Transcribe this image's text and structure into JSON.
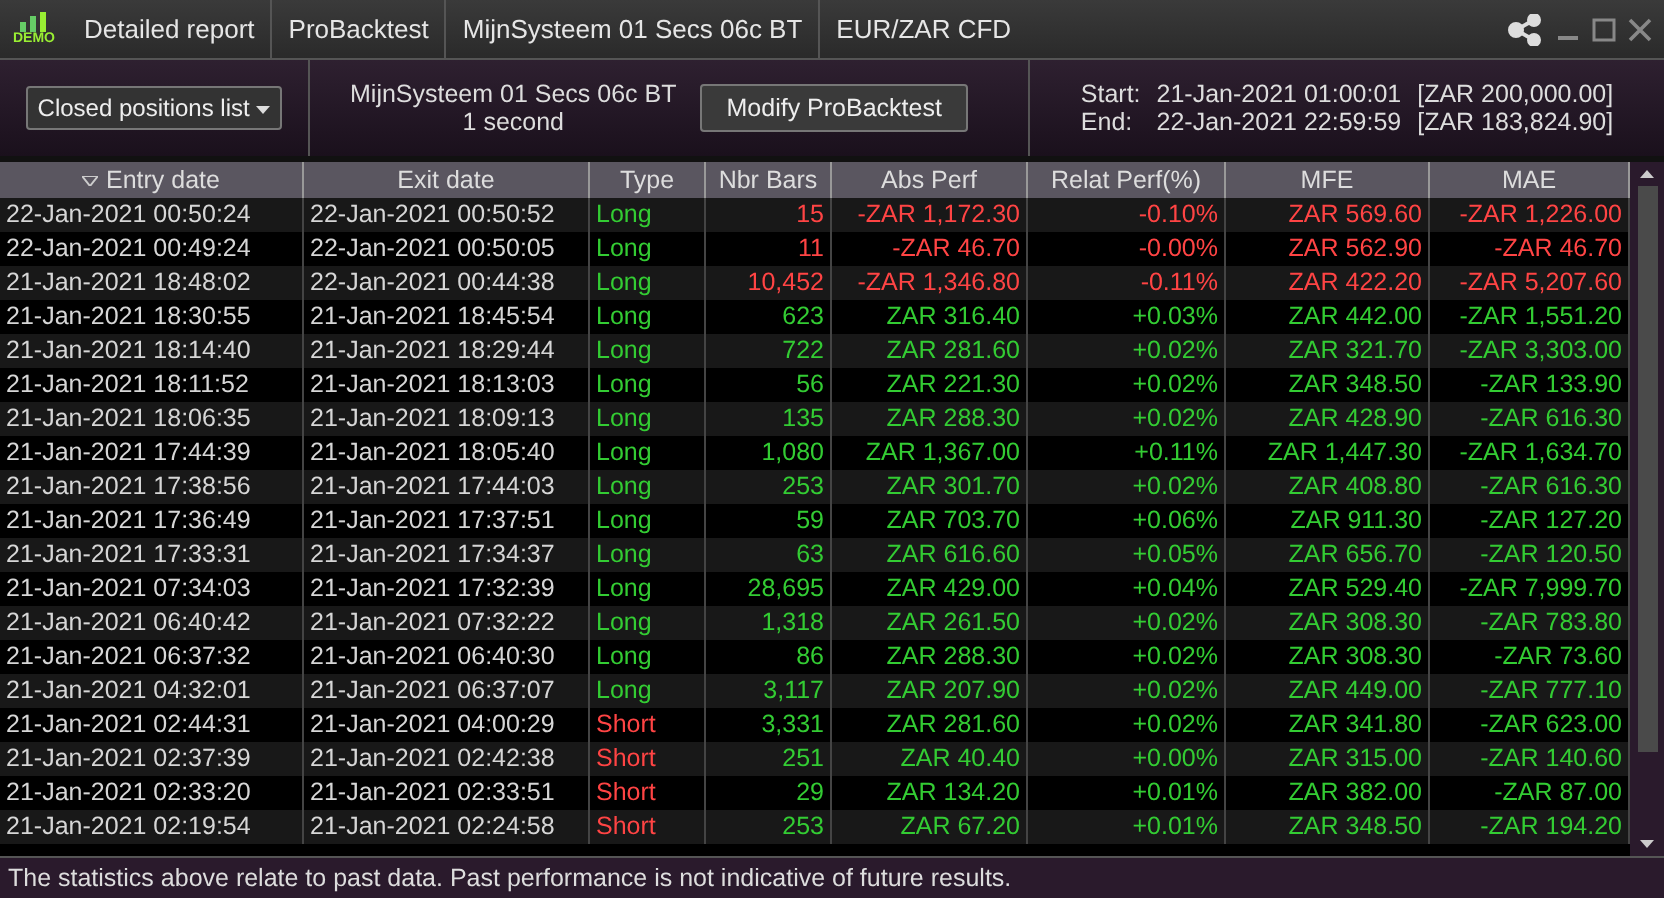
{
  "title_bar": {
    "logo_text": "DEMO",
    "tabs": [
      "Detailed report",
      "ProBacktest",
      "MijnSysteem 01 Secs 06c BT",
      "EUR/ZAR CFD"
    ]
  },
  "toolbar": {
    "list_dropdown": "Closed positions list",
    "system_name": "MijnSysteem 01 Secs 06c BT",
    "timeframe": "1 second",
    "modify_button": "Modify ProBacktest",
    "start_label": "Start:",
    "start_date": "21-Jan-2021 01:00:01",
    "start_capital": "[ZAR 200,000.00]",
    "end_label": "End:",
    "end_date": "22-Jan-2021 22:59:59",
    "end_capital": "[ZAR 183,824.90]"
  },
  "table": {
    "columns": [
      {
        "label": "Entry date",
        "sorted": true
      },
      {
        "label": "Exit date",
        "sorted": false
      },
      {
        "label": "Type",
        "sorted": false
      },
      {
        "label": "Nbr Bars",
        "sorted": false
      },
      {
        "label": "Abs Perf",
        "sorted": false
      },
      {
        "label": "Relat Perf(%)",
        "sorted": false
      },
      {
        "label": "MFE",
        "sorted": false
      },
      {
        "label": "MAE",
        "sorted": false
      }
    ],
    "rows": [
      {
        "entry": "22-Jan-2021 00:50:24",
        "exit": "22-Jan-2021 00:50:52",
        "type": "Long",
        "kind": "long",
        "loss": true,
        "bars": "15",
        "abs": "-ZAR 1,172.30",
        "rel": "-0.10%",
        "mfe": "ZAR 569.60",
        "mae": "-ZAR 1,226.00"
      },
      {
        "entry": "22-Jan-2021 00:49:24",
        "exit": "22-Jan-2021 00:50:05",
        "type": "Long",
        "kind": "long",
        "loss": true,
        "bars": "11",
        "abs": "-ZAR 46.70",
        "rel": "-0.00%",
        "mfe": "ZAR 562.90",
        "mae": "-ZAR 46.70"
      },
      {
        "entry": "21-Jan-2021 18:48:02",
        "exit": "22-Jan-2021 00:44:38",
        "type": "Long",
        "kind": "long",
        "loss": true,
        "bars": "10,452",
        "abs": "-ZAR 1,346.80",
        "rel": "-0.11%",
        "mfe": "ZAR 422.20",
        "mae": "-ZAR 5,207.60"
      },
      {
        "entry": "21-Jan-2021 18:30:55",
        "exit": "21-Jan-2021 18:45:54",
        "type": "Long",
        "kind": "long",
        "loss": false,
        "bars": "623",
        "abs": "ZAR 316.40",
        "rel": "+0.03%",
        "mfe": "ZAR 442.00",
        "mae": "-ZAR 1,551.20"
      },
      {
        "entry": "21-Jan-2021 18:14:40",
        "exit": "21-Jan-2021 18:29:44",
        "type": "Long",
        "kind": "long",
        "loss": false,
        "bars": "722",
        "abs": "ZAR 281.60",
        "rel": "+0.02%",
        "mfe": "ZAR 321.70",
        "mae": "-ZAR 3,303.00"
      },
      {
        "entry": "21-Jan-2021 18:11:52",
        "exit": "21-Jan-2021 18:13:03",
        "type": "Long",
        "kind": "long",
        "loss": false,
        "bars": "56",
        "abs": "ZAR 221.30",
        "rel": "+0.02%",
        "mfe": "ZAR 348.50",
        "mae": "-ZAR 133.90"
      },
      {
        "entry": "21-Jan-2021 18:06:35",
        "exit": "21-Jan-2021 18:09:13",
        "type": "Long",
        "kind": "long",
        "loss": false,
        "bars": "135",
        "abs": "ZAR 288.30",
        "rel": "+0.02%",
        "mfe": "ZAR 428.90",
        "mae": "-ZAR 616.30"
      },
      {
        "entry": "21-Jan-2021 17:44:39",
        "exit": "21-Jan-2021 18:05:40",
        "type": "Long",
        "kind": "long",
        "loss": false,
        "bars": "1,080",
        "abs": "ZAR 1,367.00",
        "rel": "+0.11%",
        "mfe": "ZAR 1,447.30",
        "mae": "-ZAR 1,634.70"
      },
      {
        "entry": "21-Jan-2021 17:38:56",
        "exit": "21-Jan-2021 17:44:03",
        "type": "Long",
        "kind": "long",
        "loss": false,
        "bars": "253",
        "abs": "ZAR 301.70",
        "rel": "+0.02%",
        "mfe": "ZAR 408.80",
        "mae": "-ZAR 616.30"
      },
      {
        "entry": "21-Jan-2021 17:36:49",
        "exit": "21-Jan-2021 17:37:51",
        "type": "Long",
        "kind": "long",
        "loss": false,
        "bars": "59",
        "abs": "ZAR 703.70",
        "rel": "+0.06%",
        "mfe": "ZAR 911.30",
        "mae": "-ZAR 127.20"
      },
      {
        "entry": "21-Jan-2021 17:33:31",
        "exit": "21-Jan-2021 17:34:37",
        "type": "Long",
        "kind": "long",
        "loss": false,
        "bars": "63",
        "abs": "ZAR 616.60",
        "rel": "+0.05%",
        "mfe": "ZAR 656.70",
        "mae": "-ZAR 120.50"
      },
      {
        "entry": "21-Jan-2021 07:34:03",
        "exit": "21-Jan-2021 17:32:39",
        "type": "Long",
        "kind": "long",
        "loss": false,
        "bars": "28,695",
        "abs": "ZAR 429.00",
        "rel": "+0.04%",
        "mfe": "ZAR 529.40",
        "mae": "-ZAR 7,999.70"
      },
      {
        "entry": "21-Jan-2021 06:40:42",
        "exit": "21-Jan-2021 07:32:22",
        "type": "Long",
        "kind": "long",
        "loss": false,
        "bars": "1,318",
        "abs": "ZAR 261.50",
        "rel": "+0.02%",
        "mfe": "ZAR 308.30",
        "mae": "-ZAR 783.80"
      },
      {
        "entry": "21-Jan-2021 06:37:32",
        "exit": "21-Jan-2021 06:40:30",
        "type": "Long",
        "kind": "long",
        "loss": false,
        "bars": "86",
        "abs": "ZAR 288.30",
        "rel": "+0.02%",
        "mfe": "ZAR 308.30",
        "mae": "-ZAR 73.60"
      },
      {
        "entry": "21-Jan-2021 04:32:01",
        "exit": "21-Jan-2021 06:37:07",
        "type": "Long",
        "kind": "long",
        "loss": false,
        "bars": "3,117",
        "abs": "ZAR 207.90",
        "rel": "+0.02%",
        "mfe": "ZAR 449.00",
        "mae": "-ZAR 777.10"
      },
      {
        "entry": "21-Jan-2021 02:44:31",
        "exit": "21-Jan-2021 04:00:29",
        "type": "Short",
        "kind": "short",
        "loss": false,
        "bars": "3,331",
        "abs": "ZAR 281.60",
        "rel": "+0.02%",
        "mfe": "ZAR 341.80",
        "mae": "-ZAR 623.00"
      },
      {
        "entry": "21-Jan-2021 02:37:39",
        "exit": "21-Jan-2021 02:42:38",
        "type": "Short",
        "kind": "short",
        "loss": false,
        "bars": "251",
        "abs": "ZAR 40.40",
        "rel": "+0.00%",
        "mfe": "ZAR 315.00",
        "mae": "-ZAR 140.60"
      },
      {
        "entry": "21-Jan-2021 02:33:20",
        "exit": "21-Jan-2021 02:33:51",
        "type": "Short",
        "kind": "short",
        "loss": false,
        "bars": "29",
        "abs": "ZAR 134.20",
        "rel": "+0.01%",
        "mfe": "ZAR 382.00",
        "mae": "-ZAR 87.00"
      },
      {
        "entry": "21-Jan-2021 02:19:54",
        "exit": "21-Jan-2021 02:24:58",
        "type": "Short",
        "kind": "short",
        "loss": false,
        "bars": "253",
        "abs": "ZAR 67.20",
        "rel": "+0.01%",
        "mfe": "ZAR 348.50",
        "mae": "-ZAR 194.20"
      }
    ]
  },
  "disclaimer": "The statistics above relate to past data. Past performance is not indicative of future results."
}
